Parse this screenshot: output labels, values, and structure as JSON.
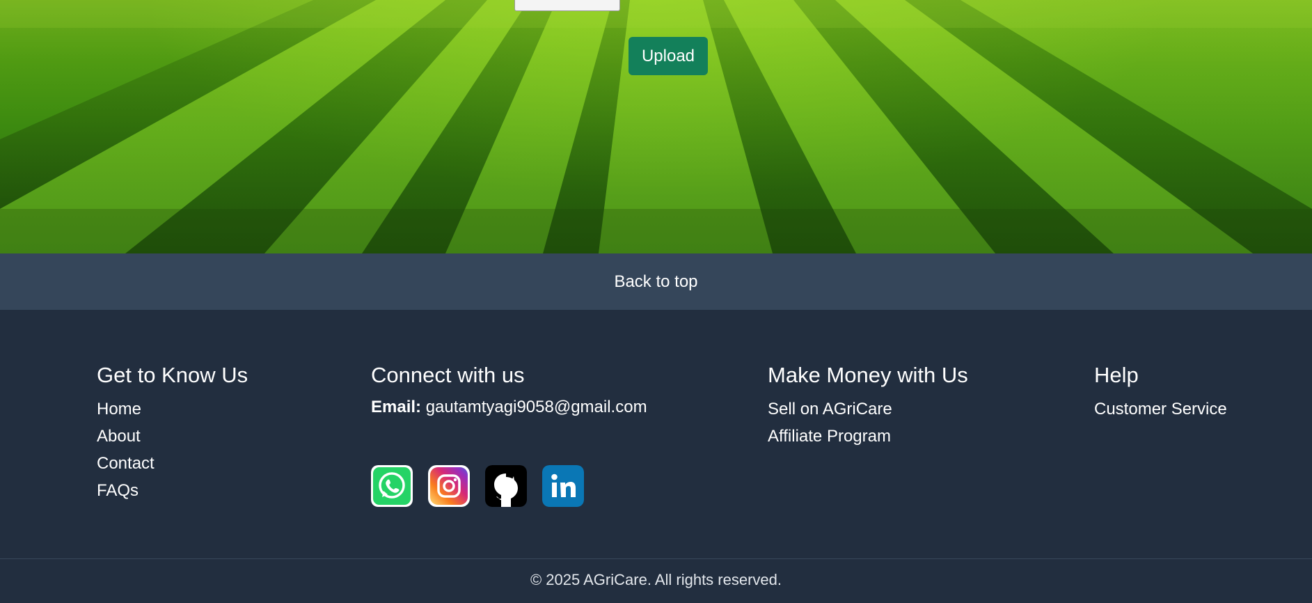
{
  "upload": {
    "button_label": "Upload"
  },
  "back_to_top": {
    "label": "Back to top"
  },
  "footer": {
    "know": {
      "heading": "Get to Know Us",
      "links": [
        "Home",
        "About",
        "Contact",
        "FAQs"
      ]
    },
    "connect": {
      "heading": "Connect with us",
      "email_label": "Email:",
      "email_value": "gautamtyagi9058@gmail.com",
      "socials": [
        "whatsapp-icon",
        "instagram-icon",
        "github-icon",
        "linkedin-icon"
      ]
    },
    "money": {
      "heading": "Make Money with Us",
      "links": [
        "Sell on AGriCare",
        "Affiliate Program"
      ]
    },
    "help": {
      "heading": "Help",
      "links": [
        "Customer Service"
      ]
    },
    "copyright": "© 2025 AGriCare. All rights reserved."
  },
  "colors": {
    "upload_button": "#13805a",
    "back_to_top_bg": "#35465a",
    "footer_bg": "#222e3f"
  }
}
